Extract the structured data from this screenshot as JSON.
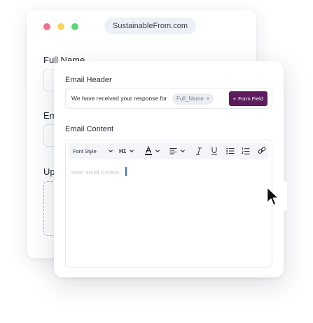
{
  "browser": {
    "url": "SustainableFrom.com",
    "dot_colors": [
      "#f2708f",
      "#f7d55b",
      "#5fd37e"
    ]
  },
  "form": {
    "full_name_label": "Full Name",
    "email_label": "Em",
    "upload_label": "Up"
  },
  "email_header": {
    "label": "Email Header",
    "text": "We have received your response for",
    "chip": "Full_Name",
    "chip_close": "×",
    "button_icon": "+",
    "button_label": "Form Field",
    "button_color": "#5d1b5e"
  },
  "email_content": {
    "label": "Email Content",
    "placeholder": "enter email content",
    "toolbar": {
      "font_style": "Font Style",
      "heading": "H1",
      "icons": [
        "font-color-icon",
        "align-left-icon",
        "italic-icon",
        "underline-icon",
        "bullet-list-icon",
        "numbered-list-icon",
        "link-icon"
      ]
    }
  }
}
